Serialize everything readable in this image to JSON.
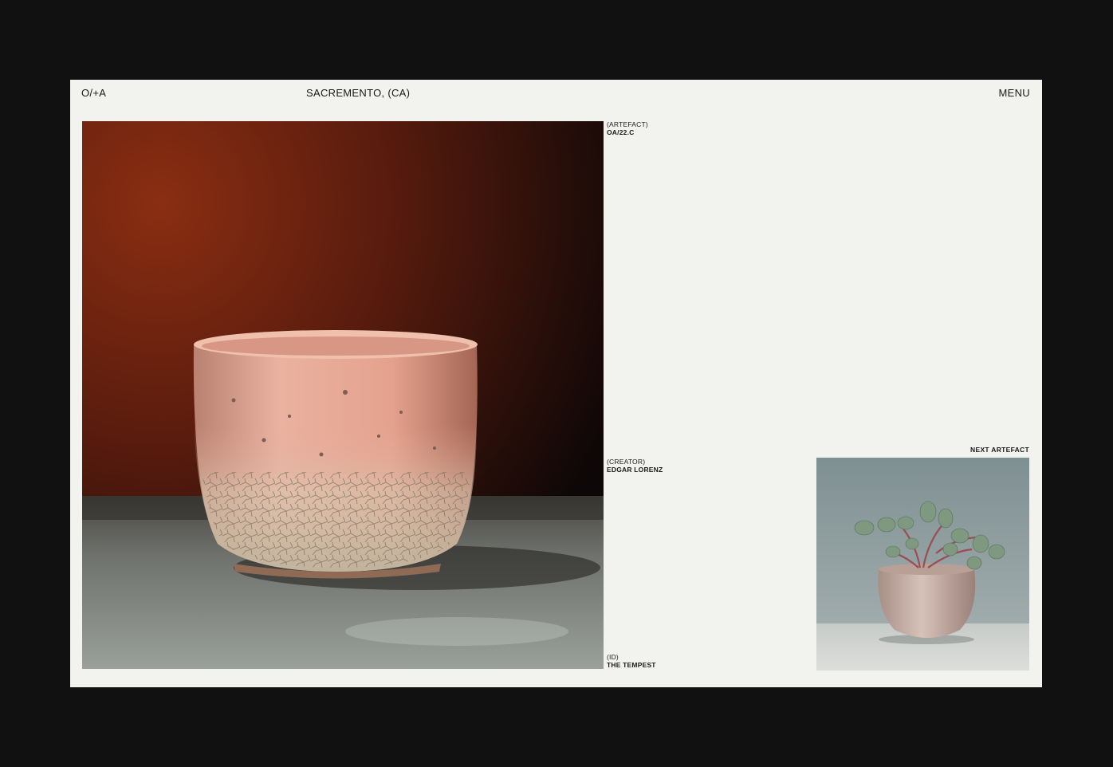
{
  "header": {
    "logo": "O/+A",
    "location": "SACREMENTO, (CA)",
    "menu_label": "MENU"
  },
  "artefact": {
    "label": "(ARTEFACT)",
    "value": "OA/22.C"
  },
  "creator": {
    "label": "(CREATOR)",
    "value": "EDGAR LORENZ"
  },
  "id": {
    "label": "(ID)",
    "value": "THE TEMPEST"
  },
  "next": {
    "label": "NEXT ARTEFACT"
  },
  "colors": {
    "page_background": "#111111",
    "card_background": "#f2f2ef",
    "text": "#1a1a1a",
    "hero_wall": "#7a2a14",
    "bowl_glaze": "#e8a893",
    "thumb_wall": "#8e9ea0"
  }
}
